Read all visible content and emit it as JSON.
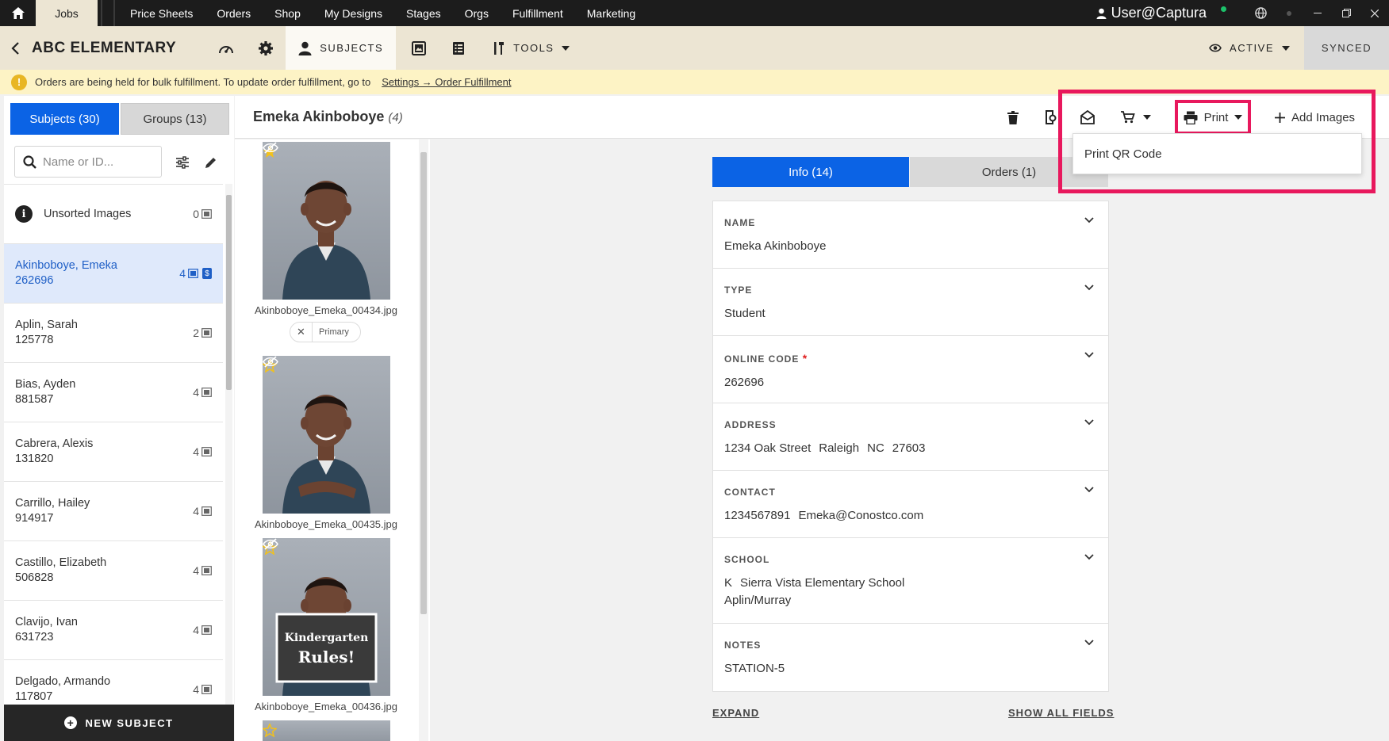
{
  "topnav": {
    "jobs": "Jobs",
    "items": [
      "Price Sheets",
      "Orders",
      "Shop",
      "My Designs",
      "Stages",
      "Orgs",
      "Fulfillment",
      "Marketing"
    ],
    "user": "User@Captura"
  },
  "jobbar": {
    "title": "ABC ELEMENTARY",
    "subjects": "SUBJECTS",
    "tools": "TOOLS",
    "status": "ACTIVE",
    "sync": "SYNCED"
  },
  "banner": {
    "text": "Orders are being held for bulk fulfillment. To update order fulfillment, go to",
    "link": "Settings → Order Fulfillment"
  },
  "sidebar": {
    "tab_subjects": "Subjects (30)",
    "tab_groups": "Groups (13)",
    "search_placeholder": "Name or ID...",
    "unsorted": {
      "label": "Unsorted Images",
      "count": "0"
    },
    "subjects": [
      {
        "name": "Akinboboye, Emeka",
        "id": "262696",
        "count": "4",
        "selected": true
      },
      {
        "name": "Aplin, Sarah",
        "id": "125778",
        "count": "2"
      },
      {
        "name": "Bias, Ayden",
        "id": "881587",
        "count": "4"
      },
      {
        "name": "Cabrera, Alexis",
        "id": "131820",
        "count": "4"
      },
      {
        "name": "Carrillo, Hailey",
        "id": "914917",
        "count": "4"
      },
      {
        "name": "Castillo, Elizabeth",
        "id": "506828",
        "count": "4"
      },
      {
        "name": "Clavijo, Ivan",
        "id": "631723",
        "count": "4"
      },
      {
        "name": "Delgado, Armando",
        "id": "117807",
        "count": "4"
      }
    ],
    "new_subject": "NEW SUBJECT"
  },
  "main": {
    "subject_name": "Emeka Akinboboye",
    "subject_count": "(4)",
    "print_label": "Print",
    "add_images": "Add Images",
    "print_menu": [
      "Print QR Code"
    ]
  },
  "thumbnails": [
    {
      "file": "Akinboboye_Emeka_00434.jpg",
      "starred": true
    },
    {
      "file": "Akinboboye_Emeka_00435.jpg",
      "starred": false
    },
    {
      "file": "Akinboboye_Emeka_00436.jpg",
      "starred": false
    }
  ],
  "primary_chip": "Primary",
  "sign_text": [
    "Kindergarten",
    "Rules!"
  ],
  "tabs": {
    "info": "Info (14)",
    "orders": "Orders (1)"
  },
  "fields": {
    "name": {
      "label": "NAME",
      "value": "Emeka Akinboboye"
    },
    "type": {
      "label": "TYPE",
      "value": "Student"
    },
    "online_code": {
      "label": "ONLINE CODE",
      "required": "*",
      "value": "262696"
    },
    "address": {
      "label": "ADDRESS",
      "street": "1234 Oak Street",
      "city": "Raleigh",
      "state": "NC",
      "zip": "27603"
    },
    "contact": {
      "label": "CONTACT",
      "phone": "1234567891",
      "email": "Emeka@Conostco.com"
    },
    "school": {
      "label": "SCHOOL",
      "grade": "K",
      "name": "Sierra Vista Elementary School",
      "teacher": "Aplin/Murray"
    },
    "notes": {
      "label": "NOTES",
      "value": "STATION-5"
    }
  },
  "footer_links": {
    "expand": "EXPAND",
    "show_all": "SHOW ALL FIELDS"
  },
  "colors": {
    "primary_blue": "#0b63e5",
    "highlight_pink": "#e8185d",
    "banner_yellow": "#fdf3c5",
    "header_beige": "#ece5d3"
  }
}
